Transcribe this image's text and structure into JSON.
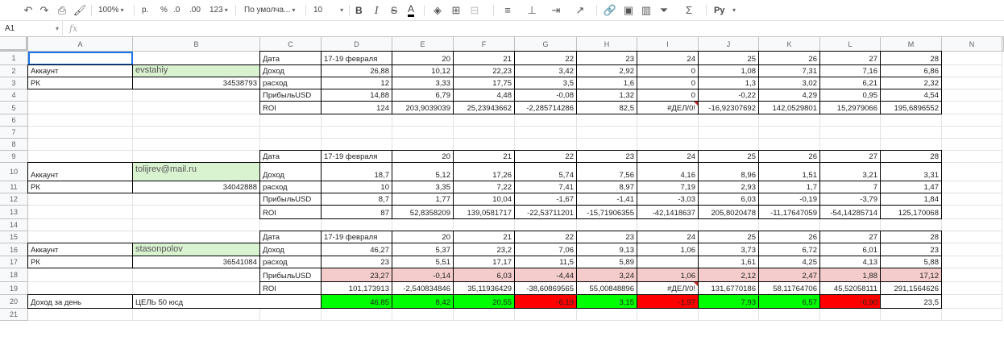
{
  "toolbar": {
    "zoom": "100%",
    "currency": "р.",
    "percent": "%",
    "dec_less": ".0",
    "dec_more": ".00",
    "format_123": "123",
    "font": "По умолча...",
    "font_size": "10",
    "bold": "B",
    "italic": "I",
    "strike": "S",
    "text_color": "A",
    "scripts": "Pу"
  },
  "formula_bar": {
    "name_box": "A1",
    "fx": "fx",
    "value": ""
  },
  "columns": [
    "A",
    "B",
    "C",
    "D",
    "E",
    "F",
    "G",
    "H",
    "I",
    "J",
    "K",
    "L",
    "M",
    "N"
  ],
  "rows": [
    "1",
    "2",
    "3",
    "4",
    "5",
    "6",
    "7",
    "8",
    "9",
    "10",
    "11",
    "12",
    "13",
    "14",
    "15",
    "16",
    "17",
    "18",
    "19",
    "20",
    "21"
  ],
  "colors": {
    "green_light": "#d9f2d0",
    "pink": "#f4cccc",
    "green": "#00ff00",
    "red": "#ff0000",
    "border": "#000000"
  },
  "cells": [
    {
      "r": 1,
      "c": 2,
      "v": "Дата"
    },
    {
      "r": 1,
      "c": 3,
      "v": "17-19 февраля"
    },
    {
      "r": 1,
      "c": 4,
      "v": "20",
      "n": 1
    },
    {
      "r": 1,
      "c": 5,
      "v": "21",
      "n": 1
    },
    {
      "r": 1,
      "c": 6,
      "v": "22",
      "n": 1
    },
    {
      "r": 1,
      "c": 7,
      "v": "23",
      "n": 1
    },
    {
      "r": 1,
      "c": 8,
      "v": "24",
      "n": 1
    },
    {
      "r": 1,
      "c": 9,
      "v": "25",
      "n": 1
    },
    {
      "r": 1,
      "c": 10,
      "v": "26",
      "n": 1
    },
    {
      "r": 1,
      "c": 11,
      "v": "27",
      "n": 1
    },
    {
      "r": 1,
      "c": 12,
      "v": "28",
      "n": 1
    },
    {
      "r": 2,
      "c": 0,
      "v": "Аккаунт"
    },
    {
      "r": 2,
      "c": 1,
      "v": "evstahiy",
      "bg": "green_light",
      "u": 1
    },
    {
      "r": 2,
      "c": 2,
      "v": "Доход"
    },
    {
      "r": 2,
      "c": 3,
      "v": "26,88",
      "n": 1
    },
    {
      "r": 2,
      "c": 4,
      "v": "10,12",
      "n": 1
    },
    {
      "r": 2,
      "c": 5,
      "v": "22,23",
      "n": 1
    },
    {
      "r": 2,
      "c": 6,
      "v": "3,42",
      "n": 1
    },
    {
      "r": 2,
      "c": 7,
      "v": "2,92",
      "n": 1
    },
    {
      "r": 2,
      "c": 8,
      "v": "0",
      "n": 1
    },
    {
      "r": 2,
      "c": 9,
      "v": "1,08",
      "n": 1
    },
    {
      "r": 2,
      "c": 10,
      "v": "7,31",
      "n": 1
    },
    {
      "r": 2,
      "c": 11,
      "v": "7,16",
      "n": 1
    },
    {
      "r": 2,
      "c": 12,
      "v": "6,86",
      "n": 1
    },
    {
      "r": 3,
      "c": 0,
      "v": "РК"
    },
    {
      "r": 3,
      "c": 1,
      "v": "34538793",
      "n": 1
    },
    {
      "r": 3,
      "c": 2,
      "v": "расход"
    },
    {
      "r": 3,
      "c": 3,
      "v": "12",
      "n": 1
    },
    {
      "r": 3,
      "c": 4,
      "v": "3,33",
      "n": 1
    },
    {
      "r": 3,
      "c": 5,
      "v": "17,75",
      "n": 1
    },
    {
      "r": 3,
      "c": 6,
      "v": "3,5",
      "n": 1
    },
    {
      "r": 3,
      "c": 7,
      "v": "1,6",
      "n": 1
    },
    {
      "r": 3,
      "c": 8,
      "v": "0",
      "n": 1
    },
    {
      "r": 3,
      "c": 9,
      "v": "1,3",
      "n": 1
    },
    {
      "r": 3,
      "c": 10,
      "v": "3,02",
      "n": 1
    },
    {
      "r": 3,
      "c": 11,
      "v": "6,21",
      "n": 1
    },
    {
      "r": 3,
      "c": 12,
      "v": "2,32",
      "n": 1
    },
    {
      "r": 4,
      "c": 2,
      "v": "ПрибыльUSD"
    },
    {
      "r": 4,
      "c": 3,
      "v": "14,88",
      "n": 1
    },
    {
      "r": 4,
      "c": 4,
      "v": "6,79",
      "n": 1
    },
    {
      "r": 4,
      "c": 5,
      "v": "4,48",
      "n": 1
    },
    {
      "r": 4,
      "c": 6,
      "v": "-0,08",
      "n": 1
    },
    {
      "r": 4,
      "c": 7,
      "v": "1,32",
      "n": 1
    },
    {
      "r": 4,
      "c": 8,
      "v": "0",
      "n": 1
    },
    {
      "r": 4,
      "c": 9,
      "v": "-0,22",
      "n": 1
    },
    {
      "r": 4,
      "c": 10,
      "v": "4,29",
      "n": 1
    },
    {
      "r": 4,
      "c": 11,
      "v": "0,95",
      "n": 1
    },
    {
      "r": 4,
      "c": 12,
      "v": "4,54",
      "n": 1
    },
    {
      "r": 5,
      "c": 2,
      "v": "ROI"
    },
    {
      "r": 5,
      "c": 3,
      "v": "124",
      "n": 1
    },
    {
      "r": 5,
      "c": 4,
      "v": "203,9039039",
      "n": 1
    },
    {
      "r": 5,
      "c": 5,
      "v": "25,23943662",
      "n": 1
    },
    {
      "r": 5,
      "c": 6,
      "v": "-2,285714286",
      "n": 1
    },
    {
      "r": 5,
      "c": 7,
      "v": "82,5",
      "n": 1
    },
    {
      "r": 5,
      "c": 8,
      "v": "#ДЕЛ/0!",
      "n": 1,
      "err": 1
    },
    {
      "r": 5,
      "c": 9,
      "v": "-16,92307692",
      "n": 1
    },
    {
      "r": 5,
      "c": 10,
      "v": "142,0529801",
      "n": 1
    },
    {
      "r": 5,
      "c": 11,
      "v": "15,2979066",
      "n": 1
    },
    {
      "r": 5,
      "c": 12,
      "v": "195,6896552",
      "n": 1
    },
    {
      "r": 9,
      "c": 2,
      "v": "Дата"
    },
    {
      "r": 9,
      "c": 3,
      "v": "17-19 февраля"
    },
    {
      "r": 9,
      "c": 4,
      "v": "20",
      "n": 1
    },
    {
      "r": 9,
      "c": 5,
      "v": "21",
      "n": 1
    },
    {
      "r": 9,
      "c": 6,
      "v": "22",
      "n": 1
    },
    {
      "r": 9,
      "c": 7,
      "v": "23",
      "n": 1
    },
    {
      "r": 9,
      "c": 8,
      "v": "24",
      "n": 1
    },
    {
      "r": 9,
      "c": 9,
      "v": "25",
      "n": 1
    },
    {
      "r": 9,
      "c": 10,
      "v": "26",
      "n": 1
    },
    {
      "r": 9,
      "c": 11,
      "v": "27",
      "n": 1
    },
    {
      "r": 9,
      "c": 12,
      "v": "28",
      "n": 1
    },
    {
      "r": 10,
      "c": 0,
      "v": "Аккаунт"
    },
    {
      "r": 10,
      "c": 1,
      "v": "tolijrev@mail.ru",
      "bg": "green_light",
      "u": 1,
      "top": 1
    },
    {
      "r": 10,
      "c": 2,
      "v": "Доход"
    },
    {
      "r": 10,
      "c": 3,
      "v": "18,7",
      "n": 1
    },
    {
      "r": 10,
      "c": 4,
      "v": "5,12",
      "n": 1
    },
    {
      "r": 10,
      "c": 5,
      "v": "17,26",
      "n": 1
    },
    {
      "r": 10,
      "c": 6,
      "v": "5,74",
      "n": 1
    },
    {
      "r": 10,
      "c": 7,
      "v": "7,56",
      "n": 1
    },
    {
      "r": 10,
      "c": 8,
      "v": "4,16",
      "n": 1
    },
    {
      "r": 10,
      "c": 9,
      "v": "8,96",
      "n": 1
    },
    {
      "r": 10,
      "c": 10,
      "v": "1,51",
      "n": 1
    },
    {
      "r": 10,
      "c": 11,
      "v": "3,21",
      "n": 1
    },
    {
      "r": 10,
      "c": 12,
      "v": "3,31",
      "n": 1
    },
    {
      "r": 11,
      "c": 0,
      "v": "РК"
    },
    {
      "r": 11,
      "c": 1,
      "v": "34042888",
      "n": 1
    },
    {
      "r": 11,
      "c": 2,
      "v": "расход"
    },
    {
      "r": 11,
      "c": 3,
      "v": "10",
      "n": 1
    },
    {
      "r": 11,
      "c": 4,
      "v": "3,35",
      "n": 1
    },
    {
      "r": 11,
      "c": 5,
      "v": "7,22",
      "n": 1
    },
    {
      "r": 11,
      "c": 6,
      "v": "7,41",
      "n": 1
    },
    {
      "r": 11,
      "c": 7,
      "v": "8,97",
      "n": 1
    },
    {
      "r": 11,
      "c": 8,
      "v": "7,19",
      "n": 1
    },
    {
      "r": 11,
      "c": 9,
      "v": "2,93",
      "n": 1
    },
    {
      "r": 11,
      "c": 10,
      "v": "1,7",
      "n": 1
    },
    {
      "r": 11,
      "c": 11,
      "v": "7",
      "n": 1
    },
    {
      "r": 11,
      "c": 12,
      "v": "1,47",
      "n": 1
    },
    {
      "r": 12,
      "c": 2,
      "v": "ПрибыльUSD"
    },
    {
      "r": 12,
      "c": 3,
      "v": "8,7",
      "n": 1
    },
    {
      "r": 12,
      "c": 4,
      "v": "1,77",
      "n": 1
    },
    {
      "r": 12,
      "c": 5,
      "v": "10,04",
      "n": 1
    },
    {
      "r": 12,
      "c": 6,
      "v": "-1,67",
      "n": 1
    },
    {
      "r": 12,
      "c": 7,
      "v": "-1,41",
      "n": 1
    },
    {
      "r": 12,
      "c": 8,
      "v": "-3,03",
      "n": 1
    },
    {
      "r": 12,
      "c": 9,
      "v": "6,03",
      "n": 1
    },
    {
      "r": 12,
      "c": 10,
      "v": "-0,19",
      "n": 1
    },
    {
      "r": 12,
      "c": 11,
      "v": "-3,79",
      "n": 1
    },
    {
      "r": 12,
      "c": 12,
      "v": "1,84",
      "n": 1
    },
    {
      "r": 13,
      "c": 2,
      "v": "ROI"
    },
    {
      "r": 13,
      "c": 3,
      "v": "87",
      "n": 1
    },
    {
      "r": 13,
      "c": 4,
      "v": "52,8358209",
      "n": 1
    },
    {
      "r": 13,
      "c": 5,
      "v": "139,0581717",
      "n": 1
    },
    {
      "r": 13,
      "c": 6,
      "v": "-22,53711201",
      "n": 1
    },
    {
      "r": 13,
      "c": 7,
      "v": "-15,71906355",
      "n": 1
    },
    {
      "r": 13,
      "c": 8,
      "v": "-42,1418637",
      "n": 1
    },
    {
      "r": 13,
      "c": 9,
      "v": "205,8020478",
      "n": 1
    },
    {
      "r": 13,
      "c": 10,
      "v": "-11,17647059",
      "n": 1
    },
    {
      "r": 13,
      "c": 11,
      "v": "-54,14285714",
      "n": 1
    },
    {
      "r": 13,
      "c": 12,
      "v": "125,170068",
      "n": 1
    },
    {
      "r": 15,
      "c": 2,
      "v": "Дата"
    },
    {
      "r": 15,
      "c": 3,
      "v": "17-19 февраля"
    },
    {
      "r": 15,
      "c": 4,
      "v": "20",
      "n": 1
    },
    {
      "r": 15,
      "c": 5,
      "v": "21",
      "n": 1
    },
    {
      "r": 15,
      "c": 6,
      "v": "22",
      "n": 1
    },
    {
      "r": 15,
      "c": 7,
      "v": "23",
      "n": 1
    },
    {
      "r": 15,
      "c": 8,
      "v": "24",
      "n": 1
    },
    {
      "r": 15,
      "c": 9,
      "v": "25",
      "n": 1
    },
    {
      "r": 15,
      "c": 10,
      "v": "26",
      "n": 1
    },
    {
      "r": 15,
      "c": 11,
      "v": "27",
      "n": 1
    },
    {
      "r": 15,
      "c": 12,
      "v": "28",
      "n": 1
    },
    {
      "r": 16,
      "c": 0,
      "v": "Аккаунт"
    },
    {
      "r": 16,
      "c": 1,
      "v": "stasonpolov",
      "bg": "green_light",
      "u": 1
    },
    {
      "r": 16,
      "c": 2,
      "v": "Доход"
    },
    {
      "r": 16,
      "c": 3,
      "v": "46,27",
      "n": 1
    },
    {
      "r": 16,
      "c": 4,
      "v": "5,37",
      "n": 1
    },
    {
      "r": 16,
      "c": 5,
      "v": "23,2",
      "n": 1
    },
    {
      "r": 16,
      "c": 6,
      "v": "7,06",
      "n": 1
    },
    {
      "r": 16,
      "c": 7,
      "v": "9,13",
      "n": 1
    },
    {
      "r": 16,
      "c": 8,
      "v": "1,06",
      "n": 1
    },
    {
      "r": 16,
      "c": 9,
      "v": "3,73",
      "n": 1
    },
    {
      "r": 16,
      "c": 10,
      "v": "6,72",
      "n": 1
    },
    {
      "r": 16,
      "c": 11,
      "v": "6,01",
      "n": 1
    },
    {
      "r": 16,
      "c": 12,
      "v": "23",
      "n": 1
    },
    {
      "r": 17,
      "c": 0,
      "v": "РК"
    },
    {
      "r": 17,
      "c": 1,
      "v": "36541084",
      "n": 1
    },
    {
      "r": 17,
      "c": 2,
      "v": "расход"
    },
    {
      "r": 17,
      "c": 3,
      "v": "23",
      "n": 1
    },
    {
      "r": 17,
      "c": 4,
      "v": "5,51",
      "n": 1
    },
    {
      "r": 17,
      "c": 5,
      "v": "17,17",
      "n": 1
    },
    {
      "r": 17,
      "c": 6,
      "v": "11,5",
      "n": 1
    },
    {
      "r": 17,
      "c": 7,
      "v": "5,89",
      "n": 1
    },
    {
      "r": 17,
      "c": 9,
      "v": "1,61",
      "n": 1
    },
    {
      "r": 17,
      "c": 10,
      "v": "4,25",
      "n": 1
    },
    {
      "r": 17,
      "c": 11,
      "v": "4,13",
      "n": 1
    },
    {
      "r": 17,
      "c": 12,
      "v": "5,88",
      "n": 1
    },
    {
      "r": 18,
      "c": 2,
      "v": "ПрибыльUSD"
    },
    {
      "r": 18,
      "c": 3,
      "v": "23,27",
      "n": 1,
      "bg": "pink"
    },
    {
      "r": 18,
      "c": 4,
      "v": "-0,14",
      "n": 1,
      "bg": "pink"
    },
    {
      "r": 18,
      "c": 5,
      "v": "6,03",
      "n": 1,
      "bg": "pink"
    },
    {
      "r": 18,
      "c": 6,
      "v": "-4,44",
      "n": 1,
      "bg": "pink"
    },
    {
      "r": 18,
      "c": 7,
      "v": "3,24",
      "n": 1,
      "bg": "pink"
    },
    {
      "r": 18,
      "c": 8,
      "v": "1,06",
      "n": 1,
      "bg": "pink"
    },
    {
      "r": 18,
      "c": 9,
      "v": "2,12",
      "n": 1,
      "bg": "pink"
    },
    {
      "r": 18,
      "c": 10,
      "v": "2,47",
      "n": 1,
      "bg": "pink"
    },
    {
      "r": 18,
      "c": 11,
      "v": "1,88",
      "n": 1,
      "bg": "pink"
    },
    {
      "r": 18,
      "c": 12,
      "v": "17,12",
      "n": 1,
      "bg": "pink"
    },
    {
      "r": 19,
      "c": 2,
      "v": "ROI"
    },
    {
      "r": 19,
      "c": 3,
      "v": "101,173913",
      "n": 1
    },
    {
      "r": 19,
      "c": 4,
      "v": "-2,540834846",
      "n": 1
    },
    {
      "r": 19,
      "c": 5,
      "v": "35,11936429",
      "n": 1
    },
    {
      "r": 19,
      "c": 6,
      "v": "-38,60869565",
      "n": 1
    },
    {
      "r": 19,
      "c": 7,
      "v": "55,00848896",
      "n": 1
    },
    {
      "r": 19,
      "c": 8,
      "v": "#ДЕЛ/0!",
      "n": 1,
      "err": 1
    },
    {
      "r": 19,
      "c": 9,
      "v": "131,6770186",
      "n": 1
    },
    {
      "r": 19,
      "c": 10,
      "v": "58,11764706",
      "n": 1
    },
    {
      "r": 19,
      "c": 11,
      "v": "45,52058111",
      "n": 1
    },
    {
      "r": 19,
      "c": 12,
      "v": "291,1564626",
      "n": 1
    },
    {
      "r": 20,
      "c": 0,
      "v": "Доход за день"
    },
    {
      "r": 20,
      "c": 1,
      "v": "ЦЕЛЬ 50 юсд",
      "span": 2
    },
    {
      "r": 20,
      "c": 3,
      "v": "46,85",
      "n": 1,
      "bg": "green"
    },
    {
      "r": 20,
      "c": 4,
      "v": "8,42",
      "n": 1,
      "bg": "green"
    },
    {
      "r": 20,
      "c": 5,
      "v": "20,55",
      "n": 1,
      "bg": "green"
    },
    {
      "r": 20,
      "c": 6,
      "v": "-6,19",
      "n": 1,
      "bg": "red"
    },
    {
      "r": 20,
      "c": 7,
      "v": "3,15",
      "n": 1,
      "bg": "green"
    },
    {
      "r": 20,
      "c": 8,
      "v": "-1,97",
      "n": 1,
      "bg": "red"
    },
    {
      "r": 20,
      "c": 9,
      "v": "7,93",
      "n": 1,
      "bg": "green"
    },
    {
      "r": 20,
      "c": 10,
      "v": "6,57",
      "n": 1,
      "bg": "green"
    },
    {
      "r": 20,
      "c": 11,
      "v": "-0,90",
      "n": 1,
      "bg": "red"
    },
    {
      "r": 20,
      "c": 12,
      "v": "23,5",
      "n": 1
    }
  ]
}
